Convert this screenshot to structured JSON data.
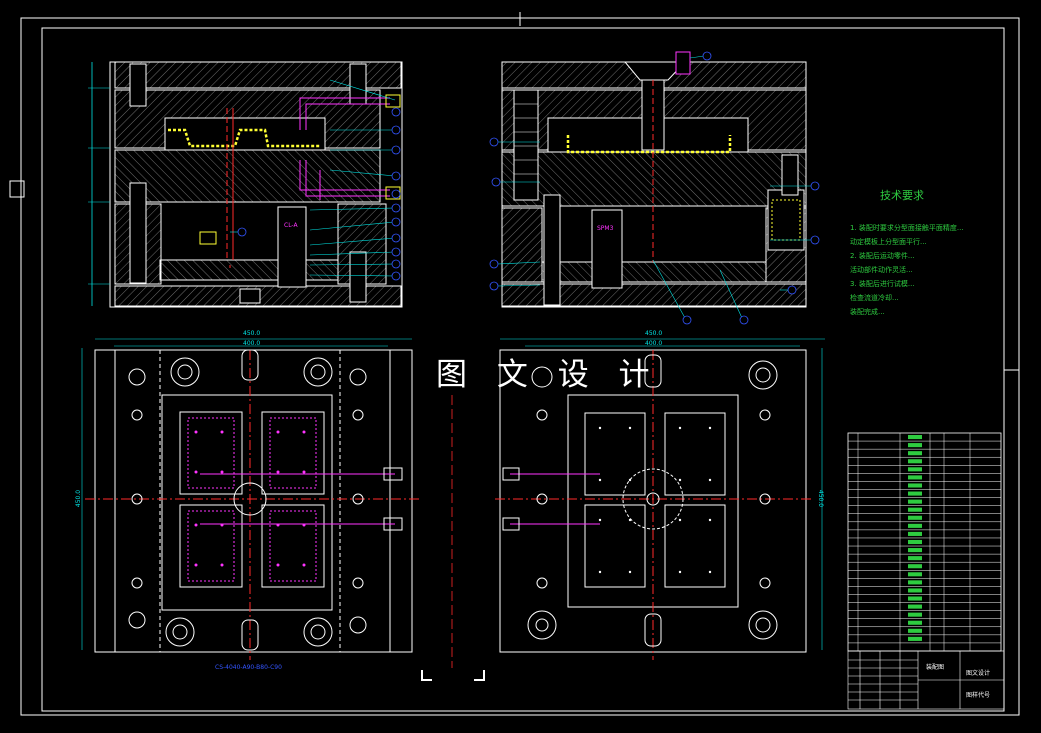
{
  "watermark": "图 文 设 计",
  "tech_requirements": {
    "title": "技术要求",
    "lines": [
      "1. 装配时要求分型面接触平面精度...",
      "动定模板上分型面平行...",
      "2. 装配后运动零件...",
      "活动部件动作灵活...",
      "3. 装配后进行试模...",
      "检查流道冷却...",
      "装配完成..."
    ]
  },
  "dimensions": {
    "left_width_outer": "450.0",
    "left_width_inner": "400.0",
    "right_width_outer": "450.0",
    "right_width_inner": "400.0",
    "left_height": "450.0",
    "right_height": "450.0"
  },
  "labels": {
    "left_inner_label": "CL-A",
    "right_inner_label": "SPM3",
    "left_bottom_caption": "CS-4040-A90-B80-C90"
  },
  "title_block": {
    "name": "装配图",
    "unit": "图文设计",
    "drawing_no": "图样代号"
  },
  "colors": {
    "frame": "#ffffff",
    "dim": "#00e5e5",
    "center": "#ff2a2a",
    "cooling": "#ff33ff",
    "highlight": "#ffff33",
    "green": "#2ecc40",
    "blue": "#3355ff"
  }
}
